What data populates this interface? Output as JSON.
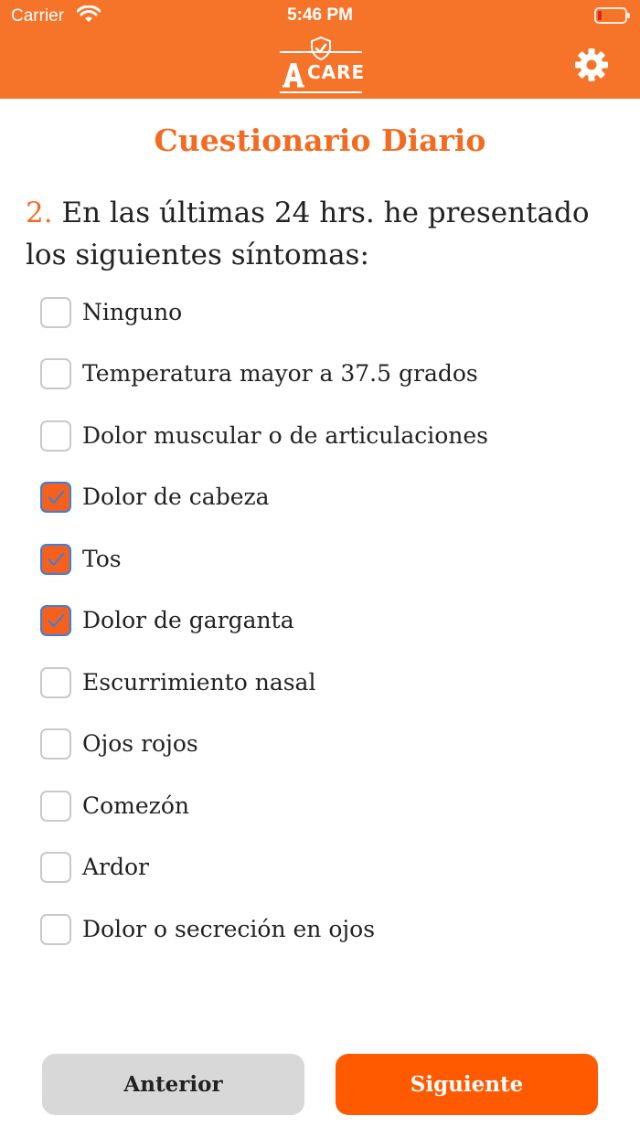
{
  "status_bar": {
    "carrier": "Carrier",
    "time": "5:46 PM"
  },
  "header": {
    "logo_text": "CARE",
    "icons": [
      "shield-check-icon",
      "gear-icon"
    ],
    "background_color": "#f5742a"
  },
  "page": {
    "title": "Cuestionario Diario"
  },
  "question": {
    "number": "2.",
    "text": "En las últimas 24 hrs. he presentado los siguientes síntomas:"
  },
  "options": [
    {
      "label": "Ninguno",
      "checked": false
    },
    {
      "label": "Temperatura mayor a 37.5 grados",
      "checked": false
    },
    {
      "label": "Dolor muscular o de articulaciones",
      "checked": false
    },
    {
      "label": "Dolor de cabeza",
      "checked": true
    },
    {
      "label": "Tos",
      "checked": true
    },
    {
      "label": "Dolor de garganta",
      "checked": true
    },
    {
      "label": "Escurrimiento nasal",
      "checked": false
    },
    {
      "label": "Ojos rojos",
      "checked": false
    },
    {
      "label": "Comezón",
      "checked": false
    },
    {
      "label": "Ardor",
      "checked": false
    },
    {
      "label": "Dolor o secreción en ojos",
      "checked": false
    }
  ],
  "buttons": {
    "previous": "Anterior",
    "next": "Siguiente"
  },
  "colors": {
    "accent": "#f26b21",
    "checkbox_checked": "#f4611f",
    "next_button": "#ff5a00",
    "previous_button": "#d8d8d8"
  }
}
